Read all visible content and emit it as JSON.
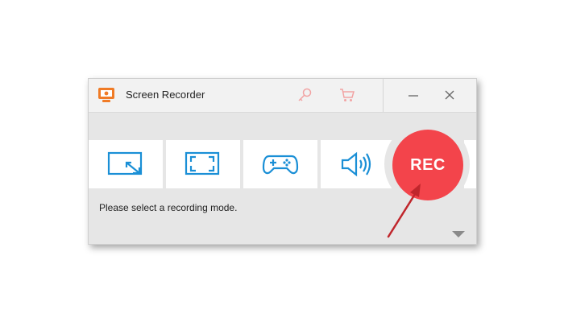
{
  "window": {
    "title": "Screen Recorder",
    "icons": {
      "app": "screen-recorder-app-icon",
      "key": "key-icon",
      "cart": "shopping-cart-icon",
      "minimize": "minimize-icon",
      "close": "close-icon"
    }
  },
  "modes": [
    {
      "name": "region-mode",
      "icon": "region-expand-icon"
    },
    {
      "name": "fullscreen-mode",
      "icon": "fullscreen-icon"
    },
    {
      "name": "game-mode",
      "icon": "gamepad-icon"
    },
    {
      "name": "audio-mode",
      "icon": "speaker-icon"
    }
  ],
  "rec_button": {
    "label": "REC"
  },
  "status_text": "Please select a recording mode.",
  "colors": {
    "accent": "#1a8fd6",
    "rec": "#f3444b",
    "annotation_arrow": "#c0262c"
  }
}
